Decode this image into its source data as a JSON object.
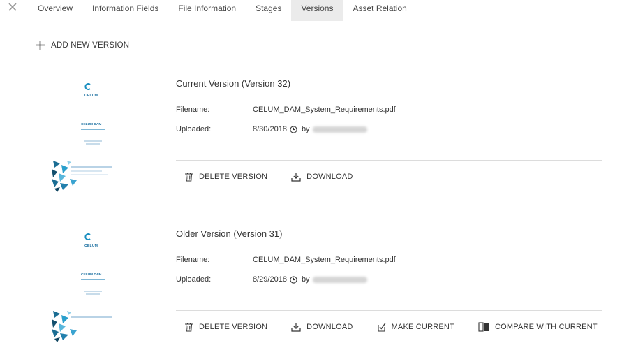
{
  "tabs": [
    {
      "label": "Overview",
      "active": false
    },
    {
      "label": "Information Fields",
      "active": false
    },
    {
      "label": "File Information",
      "active": false
    },
    {
      "label": "Stages",
      "active": false
    },
    {
      "label": "Versions",
      "active": true
    },
    {
      "label": "Asset Relation",
      "active": false
    }
  ],
  "add_version_label": "ADD NEW VERSION",
  "thumbnail": {
    "logo_text": "CELUM",
    "doc_title": "CELUM DAM"
  },
  "labels": {
    "filename": "Filename:",
    "uploaded": "Uploaded:",
    "by": "by"
  },
  "versions": [
    {
      "title": "Current Version (Version 32)",
      "filename": "CELUM_DAM_System_Requirements.pdf",
      "uploaded_date": "8/30/2018",
      "actions": [
        "DELETE VERSION",
        "DOWNLOAD"
      ]
    },
    {
      "title": "Older Version (Version 31)",
      "filename": "CELUM_DAM_System_Requirements.pdf",
      "uploaded_date": "8/29/2018",
      "actions": [
        "DELETE VERSION",
        "DOWNLOAD",
        "MAKE CURRENT",
        "COMPARE WITH CURRENT"
      ]
    }
  ],
  "icons": {
    "close": "close-icon",
    "add": "plus-icon",
    "clock": "clock-icon",
    "delete": "trash-icon",
    "download": "download-icon",
    "make_current": "checkbox-icon",
    "compare": "compare-icon"
  },
  "colors": {
    "active_tab_bg": "#ebebeb",
    "brand_blue": "#1a6fa0",
    "divider": "#dcdcdc",
    "text": "#333333"
  }
}
